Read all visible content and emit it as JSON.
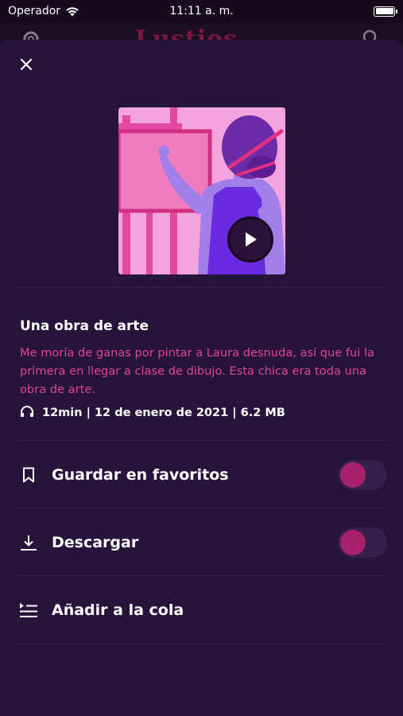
{
  "status_bar": {
    "carrier": "Operador",
    "time": "11:11 a. m."
  },
  "background_app": {
    "logo_text": "Lustios"
  },
  "episode": {
    "title": "Una obra de arte",
    "description": "Me moría de ganas por pintar a Laura desnuda, así que fui la primera en llegar a clase de dibujo. Esta chica era toda una obra de arte.",
    "meta": "12min | 12 de enero de 2021 | 6.2 MB"
  },
  "actions": {
    "favorites_label": "Guardar en favoritos",
    "favorites_enabled": false,
    "download_label": "Descargar",
    "download_enabled": false,
    "queue_label": "Añadir a la cola"
  },
  "colors": {
    "accent": "#e0449a",
    "sheet_background": "#26143a",
    "toggle_knob": "#a8226a"
  },
  "icons": {
    "close": "close-icon",
    "play": "play-icon",
    "headphones": "headphones-icon",
    "bookmark": "bookmark-icon",
    "download": "download-icon",
    "queue": "queue-icon"
  }
}
